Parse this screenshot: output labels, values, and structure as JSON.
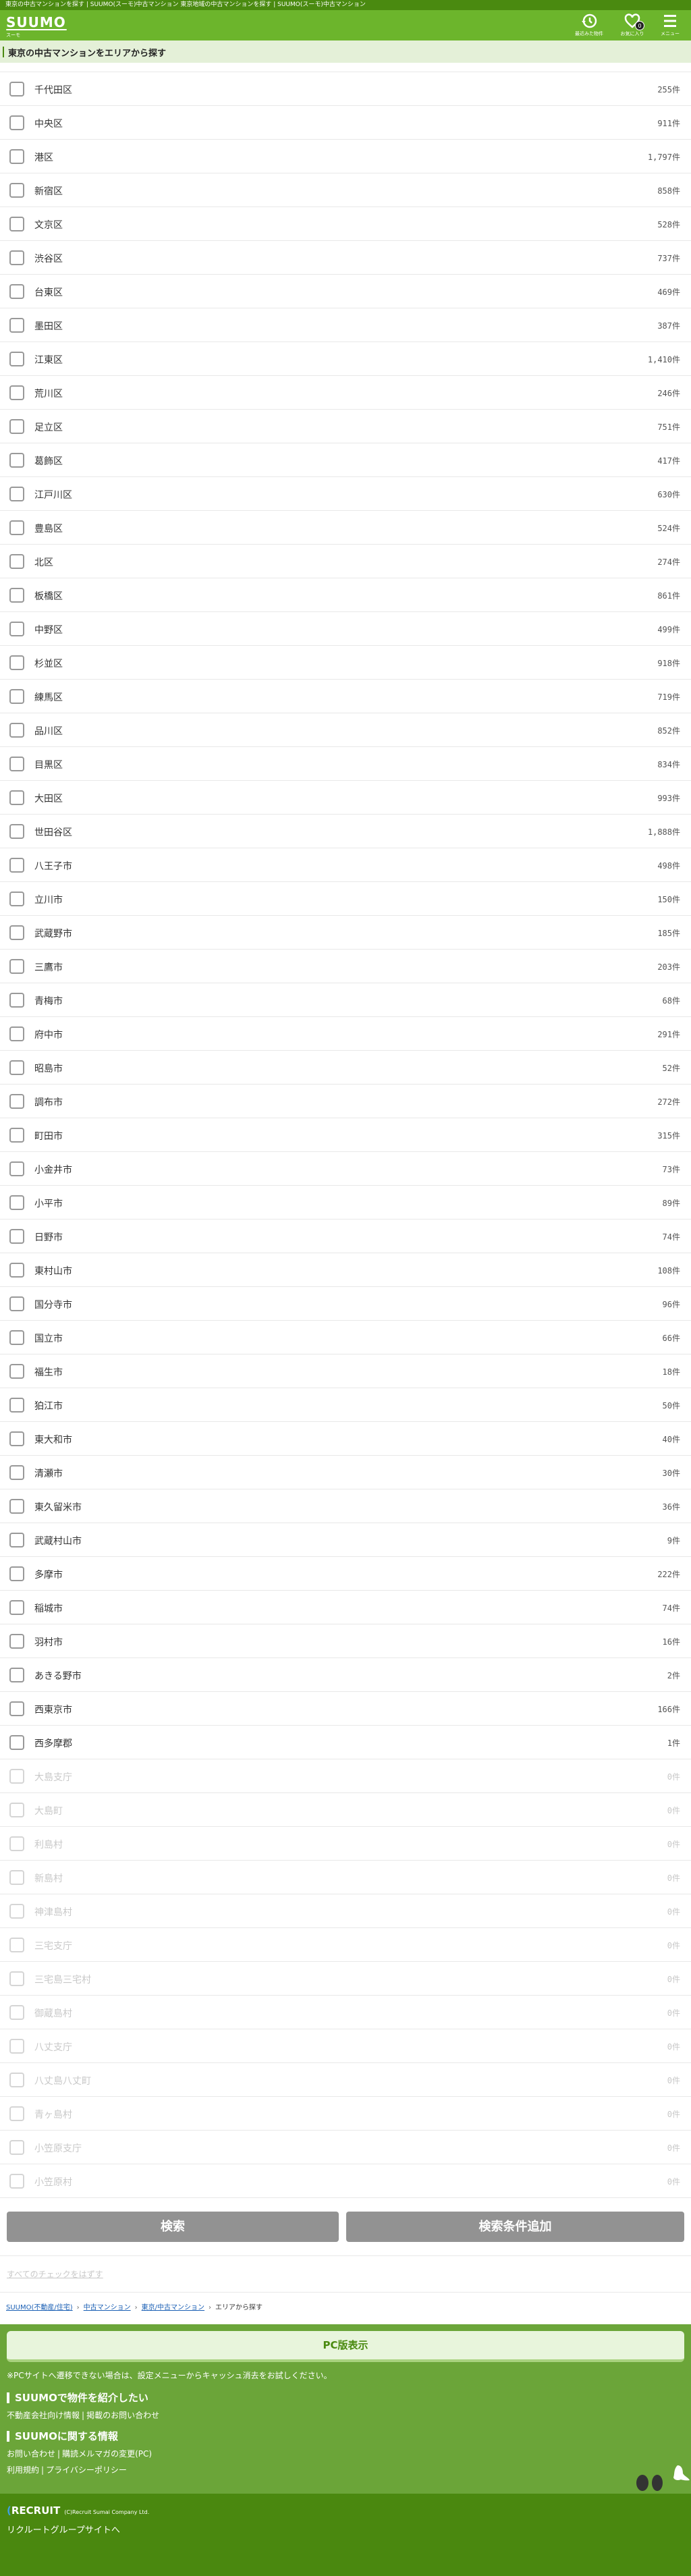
{
  "browser_title": "東京の中古マンションを探す | SUUMO(スーモ)中古マンション 東京地域の中古マンションを探す | SUUMO(スーモ)中古マンション",
  "header": {
    "logo": "SUUMO",
    "logo_sub": "スーモ",
    "recent_label": "最近みた物件",
    "favorites_label": "お気に入り",
    "favorites_count": "0",
    "menu_label": "メニュー"
  },
  "section_title": "東京の中古マンションをエリアから探す",
  "list": {
    "items": [
      {
        "name": "千代田区",
        "count": "255件",
        "enabled": true
      },
      {
        "name": "中央区",
        "count": "911件",
        "enabled": true
      },
      {
        "name": "港区",
        "count": "1,797件",
        "enabled": true
      },
      {
        "name": "新宿区",
        "count": "858件",
        "enabled": true
      },
      {
        "name": "文京区",
        "count": "528件",
        "enabled": true
      },
      {
        "name": "渋谷区",
        "count": "737件",
        "enabled": true
      },
      {
        "name": "台東区",
        "count": "469件",
        "enabled": true
      },
      {
        "name": "墨田区",
        "count": "387件",
        "enabled": true
      },
      {
        "name": "江東区",
        "count": "1,410件",
        "enabled": true
      },
      {
        "name": "荒川区",
        "count": "246件",
        "enabled": true
      },
      {
        "name": "足立区",
        "count": "751件",
        "enabled": true
      },
      {
        "name": "葛飾区",
        "count": "417件",
        "enabled": true
      },
      {
        "name": "江戸川区",
        "count": "630件",
        "enabled": true
      },
      {
        "name": "豊島区",
        "count": "524件",
        "enabled": true
      },
      {
        "name": "北区",
        "count": "274件",
        "enabled": true
      },
      {
        "name": "板橋区",
        "count": "861件",
        "enabled": true
      },
      {
        "name": "中野区",
        "count": "499件",
        "enabled": true
      },
      {
        "name": "杉並区",
        "count": "918件",
        "enabled": true
      },
      {
        "name": "練馬区",
        "count": "719件",
        "enabled": true
      },
      {
        "name": "品川区",
        "count": "852件",
        "enabled": true
      },
      {
        "name": "目黒区",
        "count": "834件",
        "enabled": true
      },
      {
        "name": "大田区",
        "count": "993件",
        "enabled": true
      },
      {
        "name": "世田谷区",
        "count": "1,888件",
        "enabled": true
      },
      {
        "name": "八王子市",
        "count": "498件",
        "enabled": true
      },
      {
        "name": "立川市",
        "count": "150件",
        "enabled": true
      },
      {
        "name": "武蔵野市",
        "count": "185件",
        "enabled": true
      },
      {
        "name": "三鷹市",
        "count": "203件",
        "enabled": true
      },
      {
        "name": "青梅市",
        "count": "68件",
        "enabled": true
      },
      {
        "name": "府中市",
        "count": "291件",
        "enabled": true
      },
      {
        "name": "昭島市",
        "count": "52件",
        "enabled": true
      },
      {
        "name": "調布市",
        "count": "272件",
        "enabled": true
      },
      {
        "name": "町田市",
        "count": "315件",
        "enabled": true
      },
      {
        "name": "小金井市",
        "count": "73件",
        "enabled": true
      },
      {
        "name": "小平市",
        "count": "89件",
        "enabled": true
      },
      {
        "name": "日野市",
        "count": "74件",
        "enabled": true
      },
      {
        "name": "東村山市",
        "count": "108件",
        "enabled": true
      },
      {
        "name": "国分寺市",
        "count": "96件",
        "enabled": true
      },
      {
        "name": "国立市",
        "count": "66件",
        "enabled": true
      },
      {
        "name": "福生市",
        "count": "18件",
        "enabled": true
      },
      {
        "name": "狛江市",
        "count": "50件",
        "enabled": true
      },
      {
        "name": "東大和市",
        "count": "40件",
        "enabled": true
      },
      {
        "name": "清瀬市",
        "count": "30件",
        "enabled": true
      },
      {
        "name": "東久留米市",
        "count": "36件",
        "enabled": true
      },
      {
        "name": "武蔵村山市",
        "count": "9件",
        "enabled": true
      },
      {
        "name": "多摩市",
        "count": "222件",
        "enabled": true
      },
      {
        "name": "稲城市",
        "count": "74件",
        "enabled": true
      },
      {
        "name": "羽村市",
        "count": "16件",
        "enabled": true
      },
      {
        "name": "あきる野市",
        "count": "2件",
        "enabled": true
      },
      {
        "name": "西東京市",
        "count": "166件",
        "enabled": true
      },
      {
        "name": "西多摩郡",
        "count": "1件",
        "enabled": true
      },
      {
        "name": "大島支庁",
        "count": "0件",
        "enabled": false
      },
      {
        "name": "大島町",
        "count": "0件",
        "enabled": false
      },
      {
        "name": "利島村",
        "count": "0件",
        "enabled": false
      },
      {
        "name": "新島村",
        "count": "0件",
        "enabled": false
      },
      {
        "name": "神津島村",
        "count": "0件",
        "enabled": false
      },
      {
        "name": "三宅支庁",
        "count": "0件",
        "enabled": false
      },
      {
        "name": "三宅島三宅村",
        "count": "0件",
        "enabled": false
      },
      {
        "name": "御蔵島村",
        "count": "0件",
        "enabled": false
      },
      {
        "name": "八丈支庁",
        "count": "0件",
        "enabled": false
      },
      {
        "name": "八丈島八丈町",
        "count": "0件",
        "enabled": false
      },
      {
        "name": "青ヶ島村",
        "count": "0件",
        "enabled": false
      },
      {
        "name": "小笠原支庁",
        "count": "0件",
        "enabled": false
      },
      {
        "name": "小笠原村",
        "count": "0件",
        "enabled": false
      }
    ]
  },
  "actions": {
    "search": "検索",
    "add_condition": "検索条件追加",
    "uncheck_all": "すべてのチェックをはずす"
  },
  "breadcrumb": [
    "SUUMO(不動産/住宅)",
    "中古マンション",
    "東京/中古マンション",
    "エリアから探す"
  ],
  "footer": {
    "pc_view": "PC版表示",
    "note": "※PCサイトへ遷移できない場合は、設定メニューからキャッシュ消去をお試しください。",
    "heading1": "SUUMOで物件を紹介したい",
    "links1": [
      "不動産会社向け情報",
      "掲載のお問い合わせ"
    ],
    "heading2": "SUUMOに関する情報",
    "links2": [
      "お問い合わせ",
      "購読メルマガの変更(PC)"
    ],
    "links3": [
      "利用規約",
      "プライバシーポリシー"
    ],
    "recruit_logo": "RECRUIT",
    "copyright": "(C)Recruit Sumai Company Ltd.",
    "group_site": "リクルートグループサイトへ"
  },
  "colors": {
    "brand": "#6cb52c",
    "dark": "#4a8a10",
    "footer": "#6ba539"
  }
}
